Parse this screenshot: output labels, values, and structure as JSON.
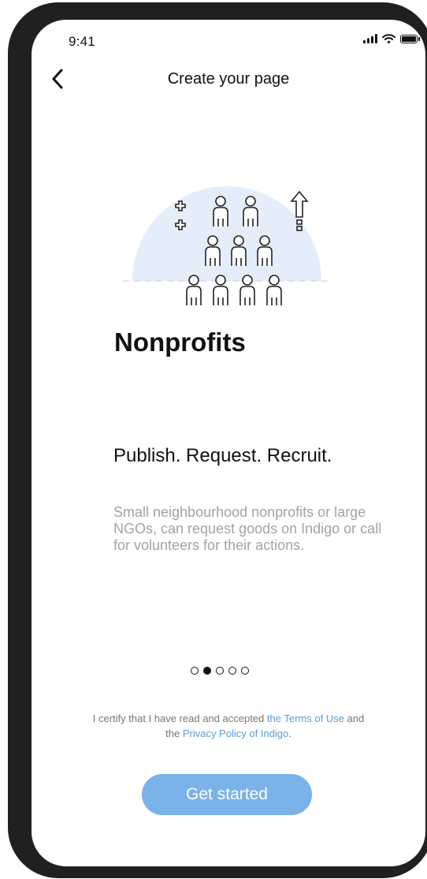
{
  "status_bar": {
    "time": "9:41",
    "icons": [
      "signal-icon",
      "wifi-icon",
      "battery-icon"
    ]
  },
  "header": {
    "back_icon": "chevron-left-icon",
    "title": "Create your page"
  },
  "illustration": {
    "icon": "people-group-icon",
    "circle_color": "#e4eefb"
  },
  "content": {
    "category": "Nonprofits",
    "headline": "Publish. Request. Recruit.",
    "description": "Small neighbourhood nonprofits or large NGOs, can request goods on Indigo or call for volunteers for their actions."
  },
  "pager": {
    "total": 5,
    "active_index": 1
  },
  "legal": {
    "prefix": "I certify that I have read and accepted ",
    "terms_link": "the Terms of Use",
    "middle": " and the ",
    "privacy_link": "Privacy Policy of Indigo",
    "suffix": "."
  },
  "cta": {
    "label": "Get started"
  },
  "colors": {
    "accent": "#7ab2ea",
    "link": "#5b9ddb",
    "muted_text": "#a3a3a3"
  }
}
